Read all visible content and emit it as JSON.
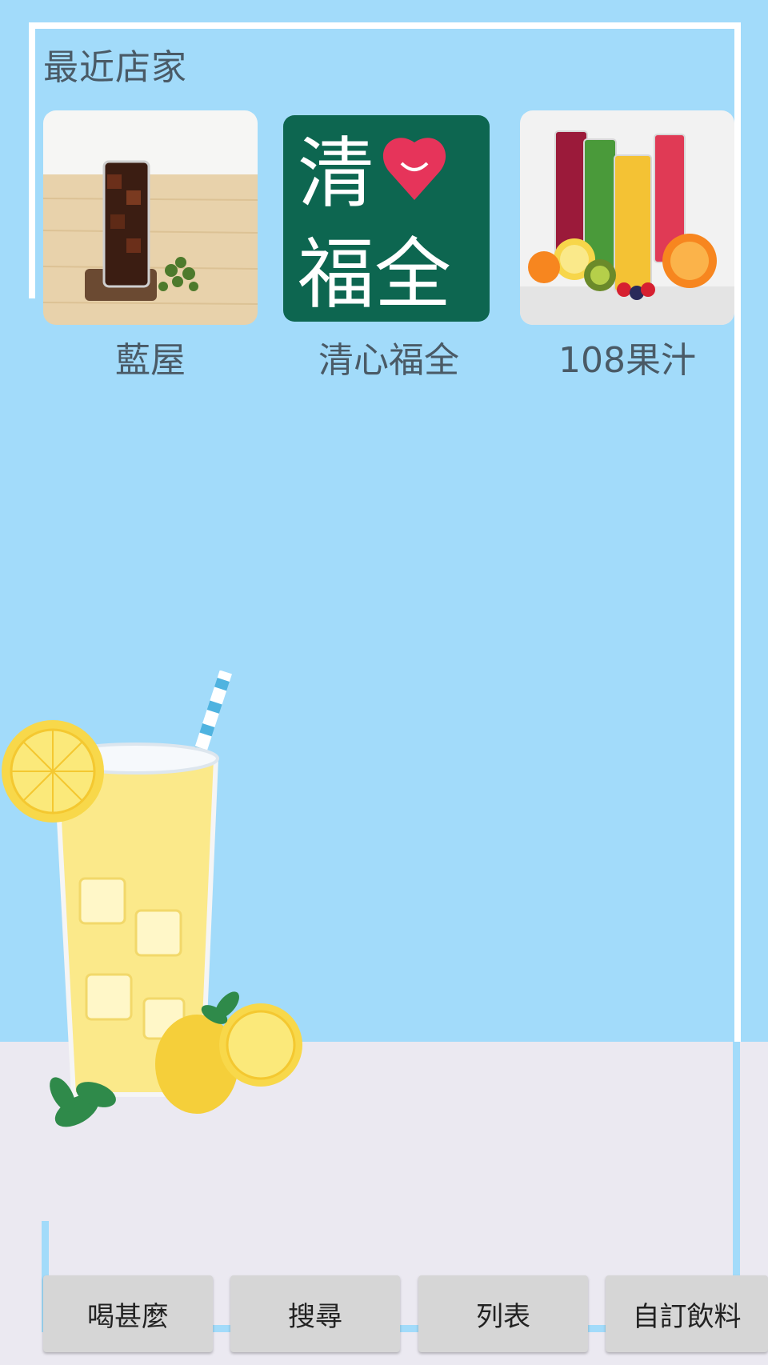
{
  "section_title": "最近店家",
  "stores": [
    {
      "name": "藍屋"
    },
    {
      "name": "清心福全",
      "logo": {
        "text_top": "清",
        "text_bottom": "福全"
      }
    },
    {
      "name": "108果汁"
    }
  ],
  "buttons": {
    "drink": "喝甚麼",
    "search": "搜尋",
    "list": "列表",
    "custom": "自訂飲料"
  },
  "colors": {
    "background_blue": "#a2dbfa",
    "background_lower": "#ebe9f1",
    "logo_green": "#0d6650",
    "heart_red": "#e6345a"
  }
}
